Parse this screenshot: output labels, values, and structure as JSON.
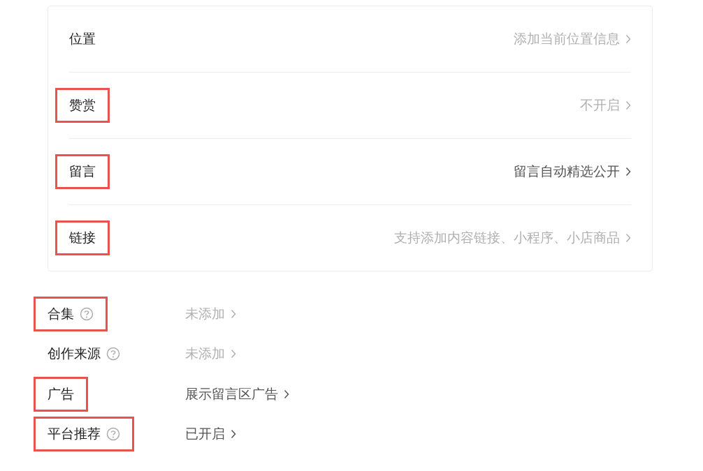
{
  "card_rows": [
    {
      "label": "位置",
      "value": "添加当前位置信息",
      "filled": false,
      "highlighted": false
    },
    {
      "label": "赞赏",
      "value": "不开启",
      "filled": false,
      "highlighted": true
    },
    {
      "label": "留言",
      "value": "留言自动精选公开",
      "filled": true,
      "highlighted": true
    },
    {
      "label": "链接",
      "value": "支持添加内容链接、小程序、小店商品",
      "filled": false,
      "highlighted": true
    }
  ],
  "settings": [
    {
      "label": "合集",
      "help": true,
      "value": "未添加",
      "filled": false,
      "highlighted": true
    },
    {
      "label": "创作来源",
      "help": true,
      "value": "未添加",
      "filled": false,
      "highlighted": false
    },
    {
      "label": "广告",
      "help": false,
      "value": "展示留言区广告",
      "filled": true,
      "highlighted": true
    },
    {
      "label": "平台推荐",
      "help": true,
      "value": "已开启",
      "filled": true,
      "highlighted": true
    }
  ]
}
